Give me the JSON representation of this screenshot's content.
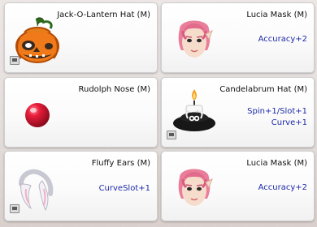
{
  "items": [
    {
      "name": "Jack-O-Lantern Hat (M)",
      "icon": "jack-o-lantern-hat-icon",
      "stats": [],
      "has_slot_badge": true
    },
    {
      "name": "Lucia Mask (M)",
      "icon": "lucia-mask-icon",
      "stats": [
        "Accuracy+2"
      ],
      "has_slot_badge": false
    },
    {
      "name": "Rudolph Nose (M)",
      "icon": "rudolph-nose-icon",
      "stats": [],
      "has_slot_badge": false
    },
    {
      "name": "Candelabrum Hat (M)",
      "icon": "candelabrum-hat-icon",
      "stats": [
        "Spin+1/Slot+1",
        "Curve+1"
      ],
      "has_slot_badge": true
    },
    {
      "name": "Fluffy Ears (M)",
      "icon": "fluffy-ears-icon",
      "stats": [
        "CurveSlot+1"
      ],
      "has_slot_badge": true
    },
    {
      "name": "Lucia Mask (M)",
      "icon": "lucia-mask-icon",
      "stats": [
        "Accuracy+2"
      ],
      "has_slot_badge": false
    }
  ],
  "colors": {
    "stat_text": "#1d2aa8",
    "name_text": "#111111",
    "card_border": "#cfcfcf"
  }
}
